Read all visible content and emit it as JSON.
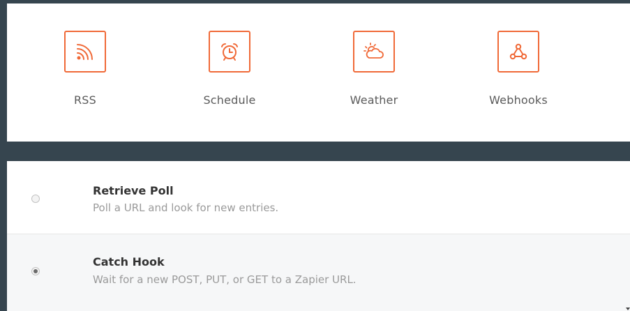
{
  "apps": [
    {
      "label": "RSS",
      "icon": "rss-icon"
    },
    {
      "label": "Schedule",
      "icon": "alarm-clock-icon"
    },
    {
      "label": "Weather",
      "icon": "sun-cloud-icon"
    },
    {
      "label": "Webhooks",
      "icon": "webhook-icon"
    }
  ],
  "options": [
    {
      "title": "Retrieve Poll",
      "description": "Poll a URL and look for new entries.",
      "selected": false
    },
    {
      "title": "Catch Hook",
      "description": "Wait for a new POST, PUT, or GET to a Zapier URL.",
      "selected": true
    }
  ],
  "colors": {
    "accent": "#f06937",
    "background": "#36454f",
    "selected_row": "#f6f7f8"
  }
}
